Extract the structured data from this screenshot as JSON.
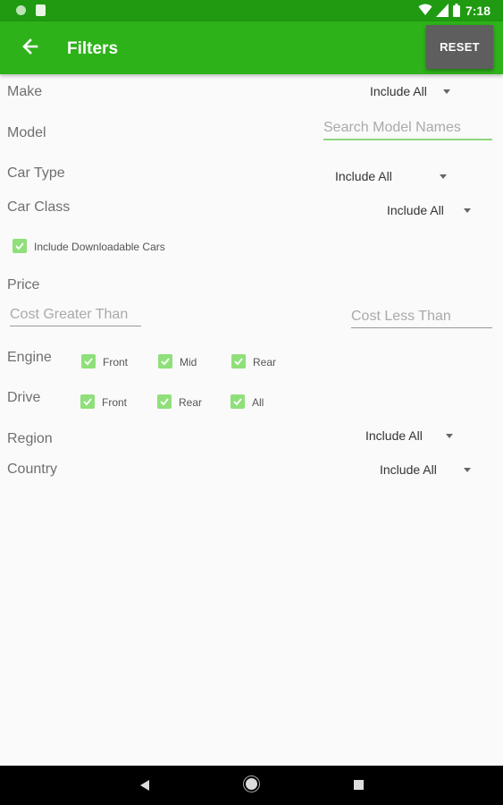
{
  "status_bar": {
    "time": "7:18"
  },
  "app_bar": {
    "title": "Filters",
    "reset_label": "RESET"
  },
  "filters": {
    "make": {
      "label": "Make",
      "value": "Include All"
    },
    "model": {
      "label": "Model",
      "placeholder": "Search Model Names"
    },
    "car_type": {
      "label": "Car Type",
      "value": "Include All"
    },
    "car_class": {
      "label": "Car Class",
      "value": "Include All"
    },
    "downloadable": {
      "label": "Include Downloadable Cars",
      "checked": true
    },
    "price": {
      "label": "Price",
      "min_placeholder": "Cost Greater Than",
      "max_placeholder": "Cost Less Than"
    },
    "engine": {
      "label": "Engine",
      "options": [
        "Front",
        "Mid",
        "Rear"
      ]
    },
    "drive": {
      "label": "Drive",
      "options": [
        "Front",
        "Rear",
        "All"
      ]
    },
    "region": {
      "label": "Region",
      "value": "Include All"
    },
    "country": {
      "label": "Country",
      "value": "Include All"
    }
  },
  "icons": {
    "back": "arrow-left-icon",
    "checkbox": "check-icon",
    "wifi": "wifi-icon",
    "battery": "battery-icon"
  },
  "colors": {
    "primary": "#2eb21a",
    "primary_dark": "#1f9a11",
    "checkbox": "#8fe07a",
    "reset_button": "#5e5e5e"
  }
}
